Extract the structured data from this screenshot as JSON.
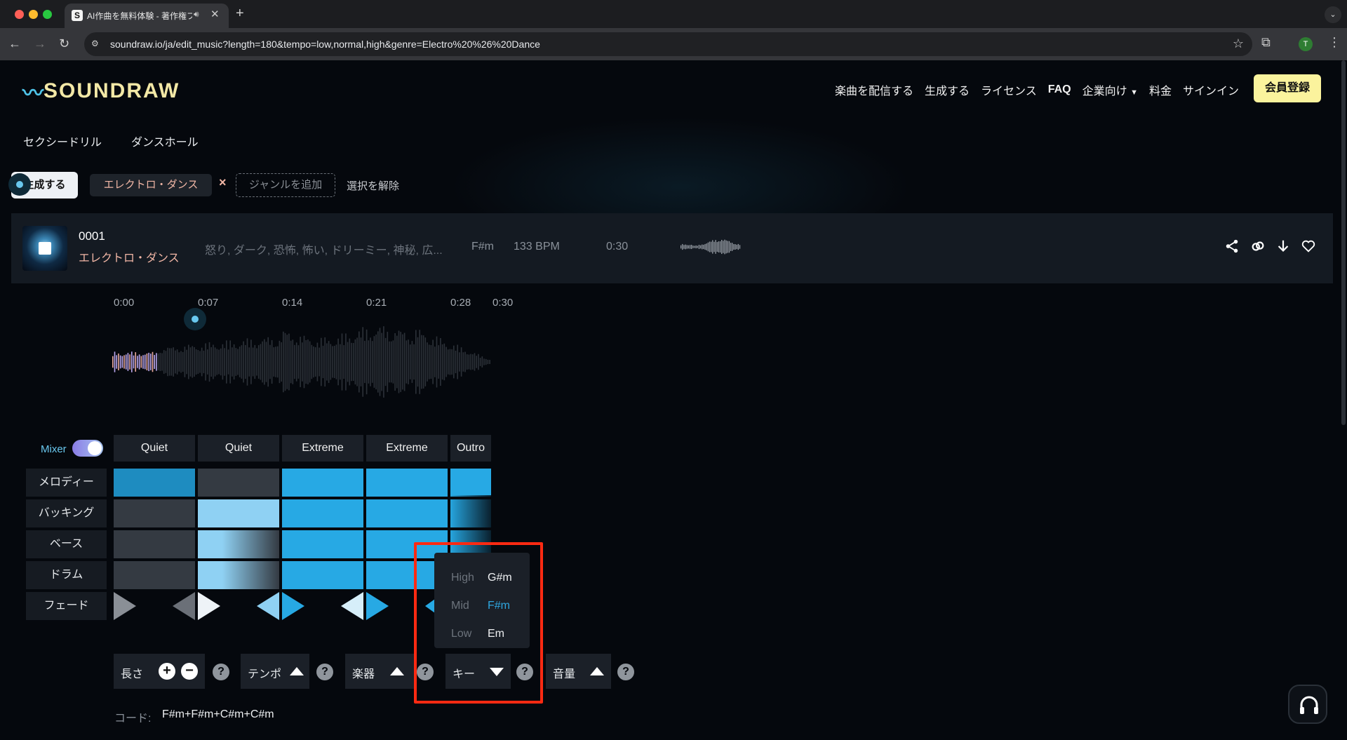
{
  "browser": {
    "tab_title": "AI作曲を無料体験 - 著作権フ",
    "tab_favicon": "S",
    "url": "soundraw.io/ja/edit_music?length=180&tempo=low,normal,high&genre=Electro%20%26%20Dance",
    "profile_initial": "T"
  },
  "header": {
    "logo_text": "SOUNDRAW",
    "nav": [
      "楽曲を配信する",
      "生成する",
      "ライセンス",
      "FAQ",
      "企業向け",
      "料金",
      "サインイン"
    ],
    "signup_label": "会員登録"
  },
  "categories": [
    "セクシードリル",
    "ダンスホール"
  ],
  "filters": {
    "generate_label": "生成する",
    "genre_chip": "エレクトロ・ダンス",
    "chip_remove": "×",
    "add_genre": "ジャンルを追加",
    "clear_label": "選択を解除"
  },
  "track": {
    "number": "0001",
    "genre": "エレクトロ・ダンス",
    "moods": "怒り, ダーク, 恐怖, 怖い, ドリーミー, 神秘, 広...",
    "key": "F#m",
    "bpm": "133 BPM",
    "duration": "0:30",
    "actions": [
      "share-icon",
      "link-icon",
      "download-icon",
      "heart-icon"
    ]
  },
  "timeline": {
    "ticks": [
      "0:00",
      "0:07",
      "0:14",
      "0:21",
      "0:28",
      "0:30"
    ]
  },
  "mixer": {
    "label": "Mixer",
    "enabled": true,
    "sections": [
      "Quiet",
      "Quiet",
      "Extreme",
      "Extreme",
      "Outro"
    ],
    "rows": [
      "メロディー",
      "バッキング",
      "ベース",
      "ドラム",
      "フェード"
    ]
  },
  "controls": {
    "length": "長さ",
    "tempo": "テンポ",
    "instruments": "楽器",
    "key": "キー",
    "volume": "音量",
    "help": "?",
    "plus": "+",
    "minus": "−"
  },
  "key_dropdown": [
    {
      "level": "High",
      "key": "G#m",
      "selected": false
    },
    {
      "level": "Mid",
      "key": "F#m",
      "selected": true
    },
    {
      "level": "Low",
      "key": "Em",
      "selected": false
    }
  ],
  "chords": {
    "label": "コード:",
    "value": "F#m+F#m+C#m+C#m"
  },
  "colors": {
    "accent": "#27a9e4",
    "brand_yellow": "#fbf39d",
    "genre_chip_text": "#f2b7a6",
    "highlight": "#ff2a12"
  }
}
